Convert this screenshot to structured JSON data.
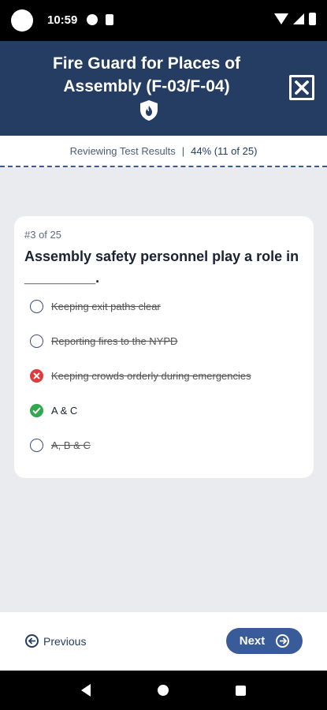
{
  "status_bar": {
    "time": "10:59"
  },
  "header": {
    "title": "Fire Guard for Places of Assembly (F-03/F-04)"
  },
  "progress": {
    "label": "Reviewing Test Results",
    "separator": "|",
    "score": "44% (11 of 25)"
  },
  "question": {
    "number": "#3 of 25",
    "text": "Assembly safety personnel play a role in _________.",
    "options": [
      {
        "label": "Keeping exit paths clear",
        "state": "eliminated"
      },
      {
        "label": "Reporting fires to the NYPD",
        "state": "eliminated"
      },
      {
        "label": "Keeping crowds orderly during emergencies",
        "state": "selected-wrong"
      },
      {
        "label": "A & C",
        "state": "correct"
      },
      {
        "label": "A, B & C",
        "state": "eliminated"
      }
    ]
  },
  "footer": {
    "previous_label": "Previous",
    "next_label": "Next"
  },
  "colors": {
    "header_bg": "#253d63",
    "accent": "#3a5b9a",
    "wrong": "#dc3c3c",
    "correct": "#2fa84f"
  }
}
